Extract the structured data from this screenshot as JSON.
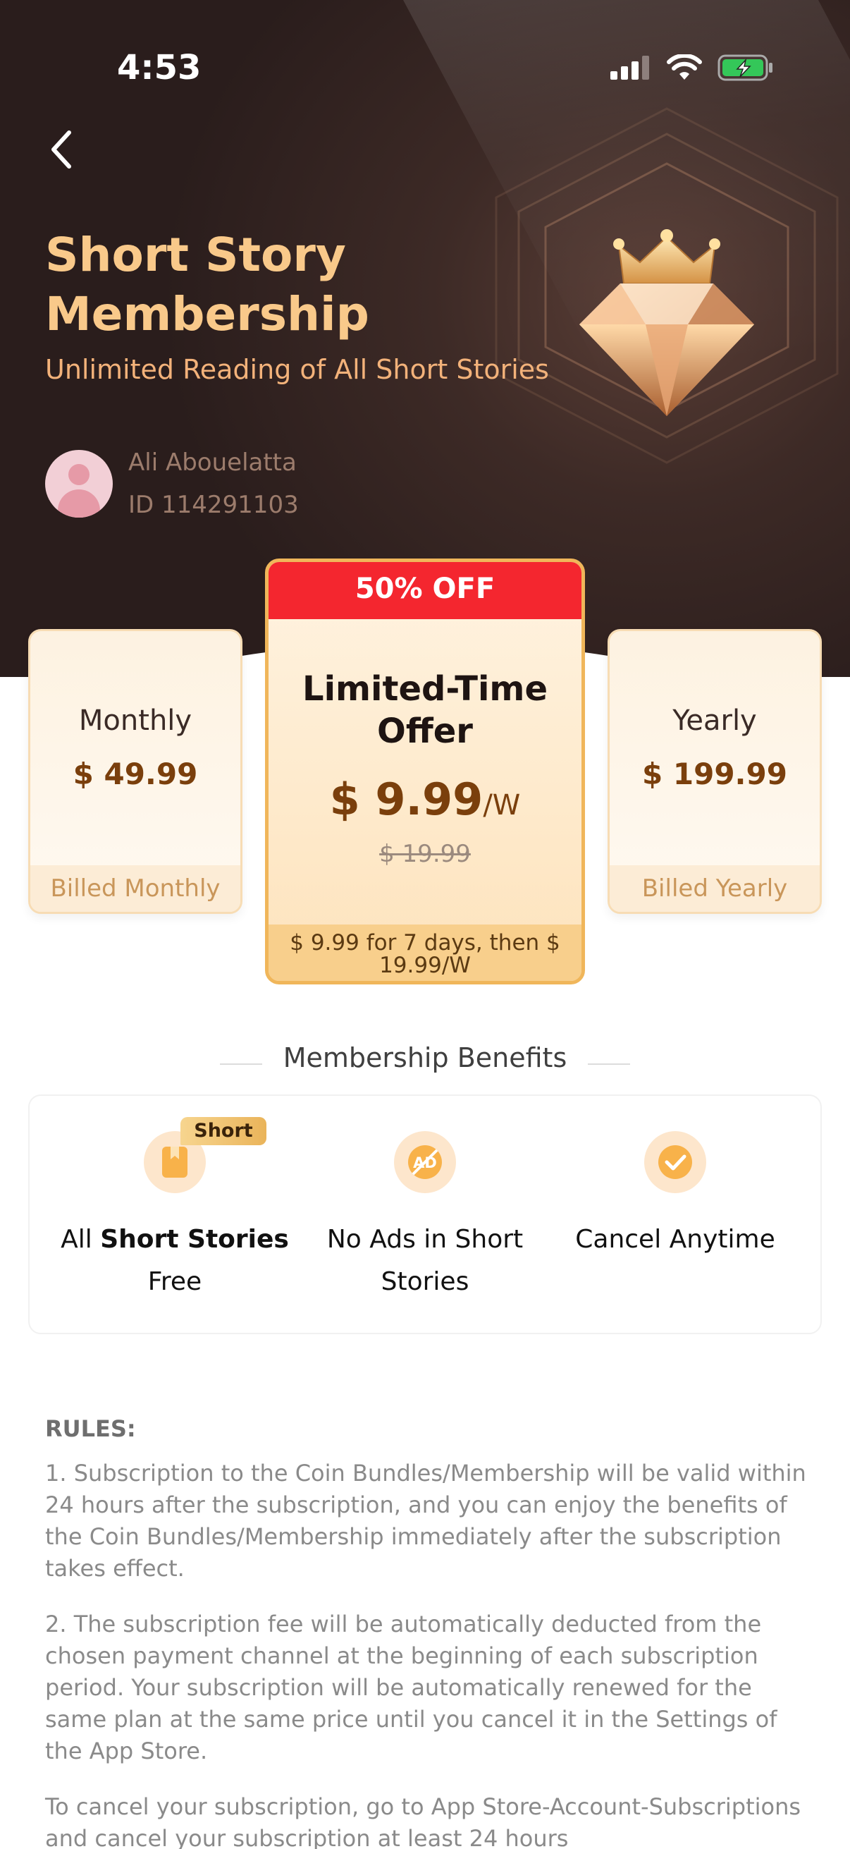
{
  "status_bar": {
    "time": "4:53"
  },
  "header": {
    "title": "Short Story Membership",
    "subtitle": "Unlimited Reading of All Short Stories"
  },
  "user": {
    "name": "Ali Abouelatta",
    "id": "ID 114291103"
  },
  "plans": {
    "monthly": {
      "name": "Monthly",
      "price": "$ 49.99",
      "billing": "Billed Monthly"
    },
    "featured": {
      "badge": "50% OFF",
      "name": "Limited-Time Offer",
      "price": "$ 9.99",
      "unit": "/W",
      "original_price": "$ 19.99",
      "footer": "$ 9.99 for 7 days, then $ 19.99/W"
    },
    "yearly": {
      "name": "Yearly",
      "price": "$ 199.99",
      "billing": "Billed Yearly"
    }
  },
  "benefits": {
    "title": "Membership Benefits",
    "items": [
      {
        "tag": "Short",
        "prefix": "All ",
        "bold": "Short Stories",
        "suffix": " Free",
        "icon": "book-icon"
      },
      {
        "label": "No Ads in Short Stories",
        "icon": "no-ads-icon"
      },
      {
        "label": "Cancel Anytime",
        "icon": "check-icon"
      }
    ]
  },
  "rules": {
    "title": "RULES:",
    "items": [
      "1. Subscription to the Coin Bundles/Membership will be valid within 24 hours after the subscription, and you can enjoy the benefits of the Coin Bundles/Membership immediately after the subscription takes effect.",
      "2. The subscription fee will be automatically deducted from the chosen payment channel at the beginning of each subscription period. Your subscription will be automatically renewed for the same plan at the same price until you cancel it in the Settings of the App Store.",
      "To cancel your subscription, go to App Store-Account-Subscriptions and cancel your subscription at least 24 hours"
    ]
  },
  "colors": {
    "hero_bg": "#2a1d1c",
    "gold_text": "#f9c98a",
    "badge_red": "#f4262f",
    "price_brown": "#7a3f0c",
    "featured_border": "#f0b65a"
  }
}
